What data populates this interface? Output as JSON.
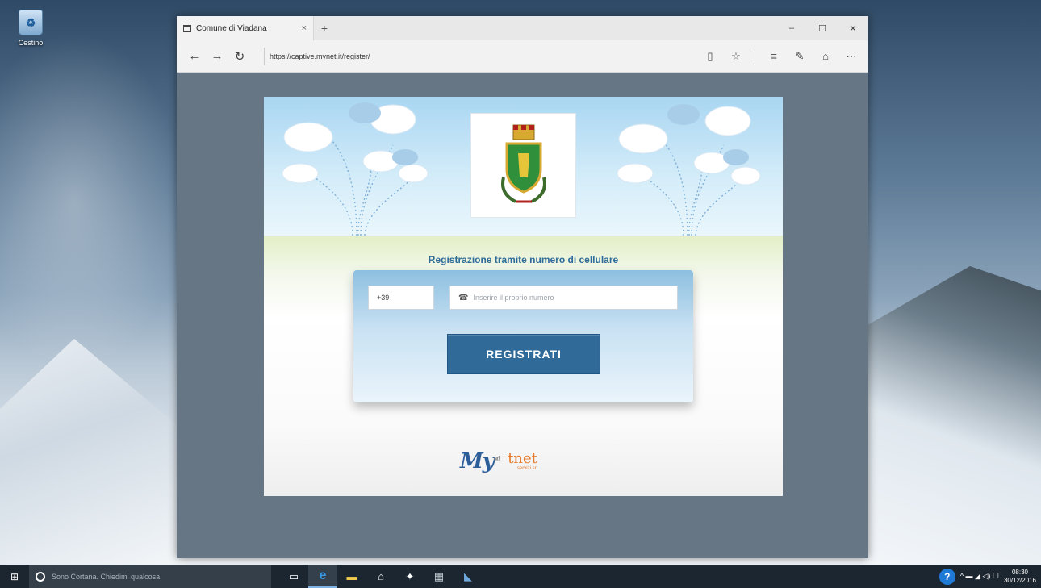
{
  "desktop": {
    "recycle_bin_label": "Cestino"
  },
  "browser": {
    "tab_title": "Comune di Viadana",
    "tab_close": "×",
    "new_tab": "+",
    "window_controls": {
      "minimize": "–",
      "maximize": "☐",
      "close": "✕"
    },
    "nav": {
      "back": "←",
      "forward": "→",
      "refresh": "↻"
    },
    "url": "https://captive.mynet.it/register/",
    "toolbar_glyphs": {
      "reading_view": "▯",
      "favorite": "☆",
      "hub": "≡",
      "web_note": "✎",
      "share": "⌂",
      "more": "···"
    }
  },
  "portal": {
    "headline": "Registrazione tramite numero di cellulare",
    "prefix_value": "+39",
    "phone_placeholder": "Inserire il proprio numero",
    "phone_icon_glyph": "☎",
    "register_label": "REGISTRATI",
    "logo_my": "My",
    "logo_my_sup": "srl",
    "logo_tnet": "tnet",
    "logo_tnet_sub": "servizi srl"
  },
  "taskbar": {
    "start_glyph": "⊞",
    "cortana_placeholder": "Sono Cortana. Chiedimi qualcosa.",
    "task_glyphs": {
      "task_view": "▭",
      "edge": "e",
      "explorer": "▬",
      "store": "⌂",
      "app": "✦",
      "app2": "▦",
      "app3": "◣"
    },
    "tray_help": "?",
    "tray_glyphs": "^ ▬ ◢ ◁) ☐",
    "clock_time": "08:30",
    "clock_date": "30/12/2016"
  },
  "colors": {
    "accent": "#2f6a99",
    "headline": "#2e6c9a",
    "browser_content_bg": "#667684",
    "taskbar": "#1c2630"
  }
}
